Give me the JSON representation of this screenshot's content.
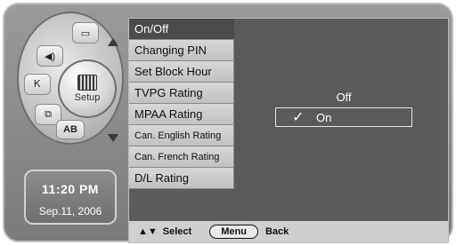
{
  "dial": {
    "setup_label": "Setup",
    "segments": [
      {
        "name": "display-icon",
        "symbol": "▭"
      },
      {
        "name": "sound-icon",
        "symbol": "◀)"
      },
      {
        "name": "channel-icon",
        "symbol": "Ꮶ"
      },
      {
        "name": "picture-icon",
        "symbol": "⧉"
      },
      {
        "name": "ab-button",
        "symbol": "AB"
      }
    ]
  },
  "clock": {
    "time": "11:20 PM",
    "date": "Sep.11, 2006"
  },
  "menu": {
    "items": [
      {
        "label": "On/Off",
        "active": true
      },
      {
        "label": "Changing PIN",
        "active": false
      },
      {
        "label": "Set Block Hour",
        "active": false
      },
      {
        "label": "TVPG Rating",
        "active": false
      },
      {
        "label": "MPAA Rating",
        "active": false
      },
      {
        "label": "Can. English Rating",
        "active": false
      },
      {
        "label": "Can. French Rating",
        "active": false
      },
      {
        "label": "D/L Rating",
        "active": false
      }
    ]
  },
  "options": {
    "items": [
      {
        "label": "Off",
        "selected": false
      },
      {
        "label": "On",
        "selected": true
      }
    ],
    "check_symbol": "✓"
  },
  "footer": {
    "nav_arrows": "▲▼",
    "select_label": "Select",
    "menu_button": "Menu",
    "back_label": "Back"
  }
}
